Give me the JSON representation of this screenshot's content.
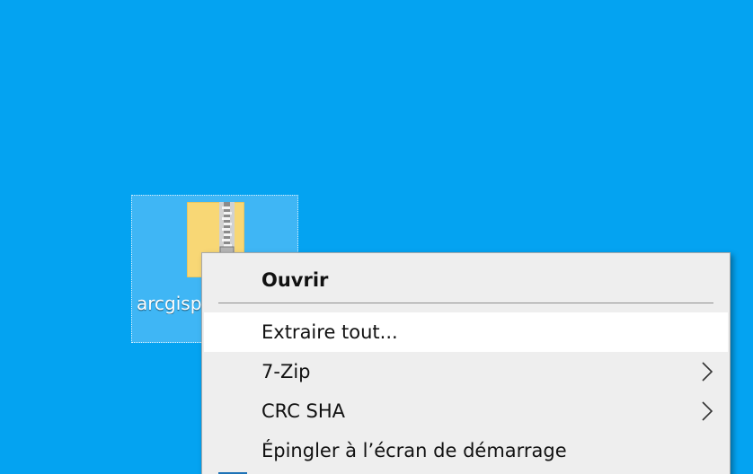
{
  "desktop": {
    "background_color": "#04a3f1",
    "icon": {
      "label": "arcgisp",
      "icon_name": "zip-folder-icon",
      "selected": true
    }
  },
  "context_menu": {
    "items": [
      {
        "label": "Ouvrir",
        "bold": true,
        "has_submenu": false
      },
      {
        "label": "Extraire tout...",
        "bold": false,
        "has_submenu": false,
        "hovered": true
      },
      {
        "label": "7-Zip",
        "bold": false,
        "has_submenu": true
      },
      {
        "label": "CRC SHA",
        "bold": false,
        "has_submenu": true
      },
      {
        "label": "Épingler à l’écran de démarrage",
        "bold": false,
        "has_submenu": false
      }
    ],
    "submenu_arrow_icon": "chevron-right-icon"
  }
}
